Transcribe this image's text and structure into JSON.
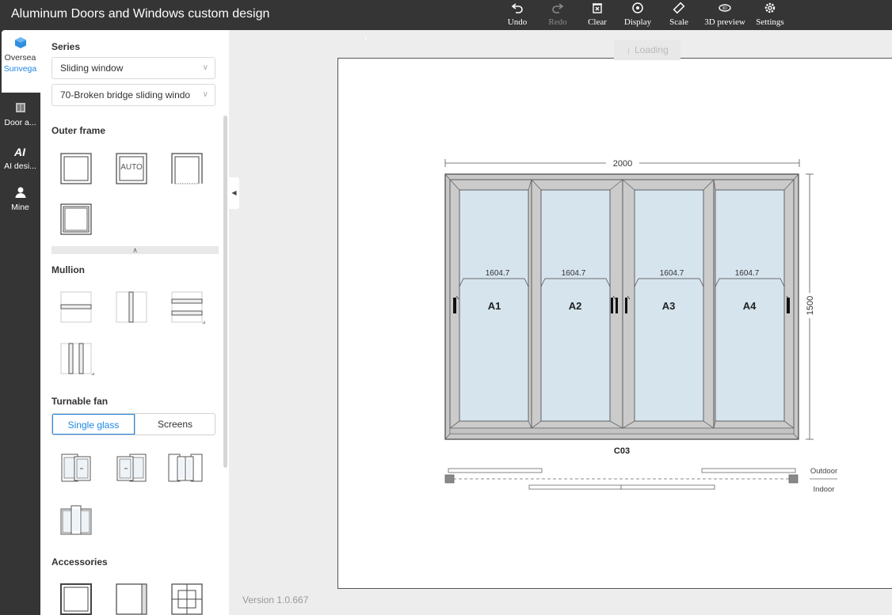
{
  "header": {
    "title": "Aluminum Doors and Windows custom design",
    "tools": [
      {
        "label": "Undo",
        "icon": "undo-icon"
      },
      {
        "label": "Redo",
        "icon": "redo-icon"
      },
      {
        "label": "Clear",
        "icon": "clear-icon"
      },
      {
        "label": "Display",
        "icon": "eye-icon"
      },
      {
        "label": "Scale",
        "icon": "ruler-icon"
      },
      {
        "label": "3D preview",
        "icon": "3d-preview-icon"
      },
      {
        "label": "Settings",
        "icon": "gear-icon"
      }
    ]
  },
  "rail": {
    "items": [
      {
        "label1": "Oversea",
        "label2": "Sunvega",
        "icon": "cube-icon"
      },
      {
        "label": "Door a...",
        "icon": "door-icon"
      },
      {
        "label": "AI desi...",
        "icon": "ai-icon"
      },
      {
        "label": "Mine",
        "icon": "user-icon"
      }
    ]
  },
  "panel": {
    "series_title": "Series",
    "series_select": "Sliding window",
    "model_select": "70-Broken bridge sliding windo",
    "outer_frame_title": "Outer frame",
    "auto_label": "AUTO",
    "mullion_title": "Mullion",
    "turnable_fan_title": "Turnable fan",
    "tab_single": "Single glass",
    "tab_screens": "Screens",
    "accessories_title": "Accessories"
  },
  "canvas": {
    "loading": "Loading",
    "width_dim": "2000",
    "height_dim": "1500",
    "code": "C03",
    "outdoor": "Outdoor",
    "indoor": "Indoor",
    "panels": [
      {
        "label": "A1",
        "dim": "1604.7"
      },
      {
        "label": "A2",
        "dim": "1604.7"
      },
      {
        "label": "A3",
        "dim": "1604.7"
      },
      {
        "label": "A4",
        "dim": "1604.7"
      }
    ]
  },
  "version": "Version 1.0.667",
  "colors": {
    "header_bg": "#353535",
    "accent": "#1e88e5",
    "glass": "#d6e4ee",
    "frame": "#c8c8c8"
  }
}
